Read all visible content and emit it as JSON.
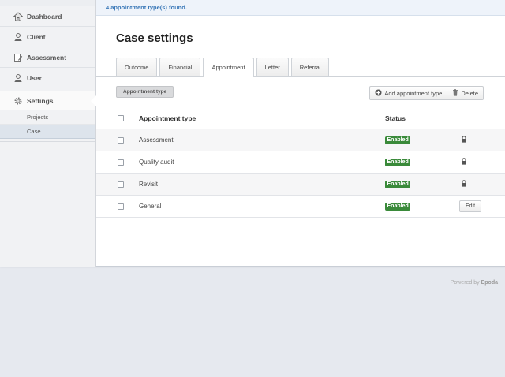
{
  "sidebar": {
    "items": [
      {
        "label": "Dashboard",
        "icon": "home-icon"
      },
      {
        "label": "Client",
        "icon": "user-icon"
      },
      {
        "label": "Assessment",
        "icon": "document-edit-icon"
      },
      {
        "label": "User",
        "icon": "user-icon"
      },
      {
        "label": "Settings",
        "icon": "gear-icon"
      }
    ],
    "subitems": [
      {
        "label": "Projects"
      },
      {
        "label": "Case",
        "selected": true
      }
    ]
  },
  "notice": "4 appointment type(s) found.",
  "page_title": "Case settings",
  "tabs": [
    {
      "label": "Outcome"
    },
    {
      "label": "Financial"
    },
    {
      "label": "Appointment",
      "active": true
    },
    {
      "label": "Letter"
    },
    {
      "label": "Referral"
    }
  ],
  "filter_chip": "Appointment type",
  "toolbar": {
    "add_label": "Add appointment type",
    "delete_label": "Delete"
  },
  "table": {
    "headers": {
      "name": "Appointment type",
      "status": "Status"
    },
    "rows": [
      {
        "name": "Assessment",
        "status": "Enabled",
        "action": "lock"
      },
      {
        "name": "Quality audit",
        "status": "Enabled",
        "action": "lock"
      },
      {
        "name": "Revisit",
        "status": "Enabled",
        "action": "lock"
      },
      {
        "name": "General",
        "status": "Enabled",
        "action": "Edit"
      }
    ]
  },
  "footer": {
    "prefix": "Powered by",
    "brand": "Epoda"
  },
  "colors": {
    "status_enabled": "#3a8a3a",
    "notice_text": "#3a78b8"
  }
}
